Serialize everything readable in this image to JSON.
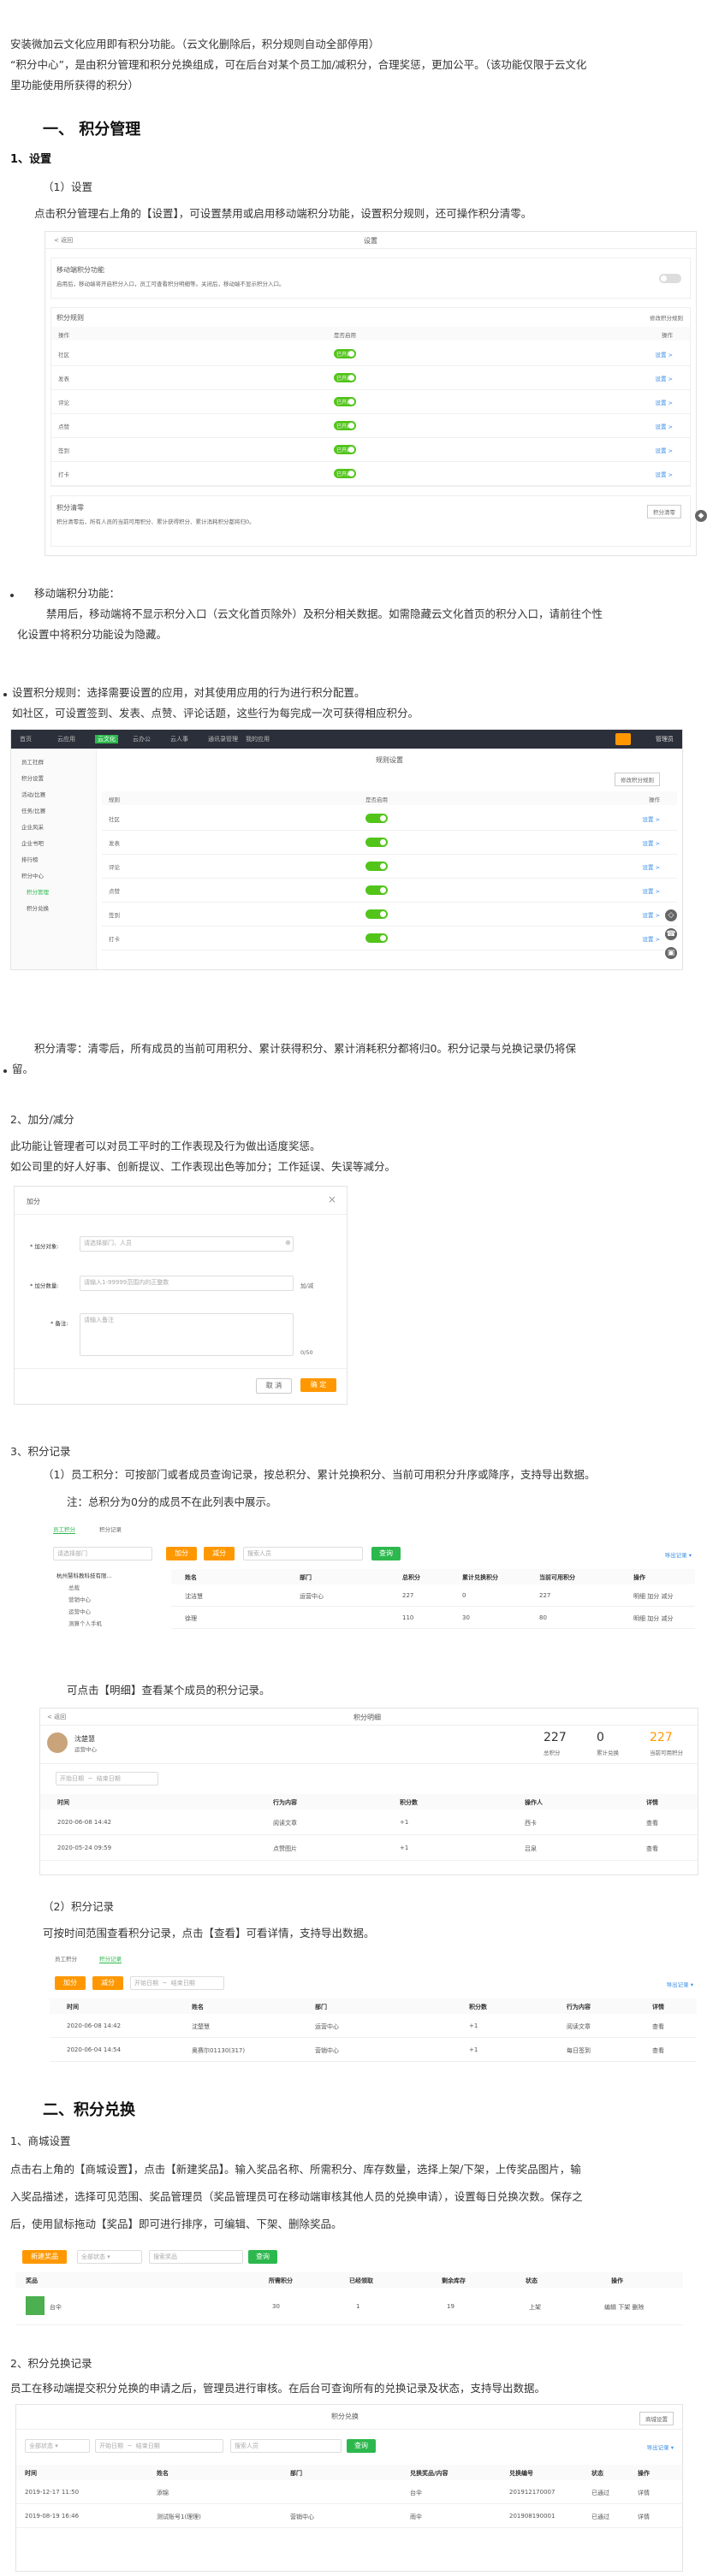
{
  "intro": {
    "line1": "安装微加云文化应用即有积分功能。（云文化删除后，积分规则自动全部停用）",
    "line2": "“积分中心”，是由积分管理和积分兑换组成，可在后台对某个员工加/减积分，合理奖惩，更加公平。（该功能仅限于云文化",
    "line3": "里功能使用所获得的积分）"
  },
  "sec1": {
    "title": "一、 积分管理",
    "s1": "1、设置",
    "s1a": "（1）设置",
    "s1a_text": "点击积分管理右上角的【设置】，可设置禁用或启用移动端积分功能，设置积分规则，还可操作积分清零。",
    "shot1": {
      "back": "< 返回",
      "title": "设置",
      "section1": "移动端积分功能",
      "section1_desc": "启用后，移动端将开启积分入口，员工可查看积分明细等。关闭后，移动端不显示积分入口。",
      "rules_title": "积分规则",
      "rules_link": "修改积分规则",
      "cols": [
        "操作",
        "是否启用",
        "操作"
      ],
      "rows": [
        {
          "name": "社区",
          "on": "已开启",
          "op": "设置 >"
        },
        {
          "name": "发表",
          "on": "已开启",
          "op": "设置 >"
        },
        {
          "name": "评论",
          "on": "已开启",
          "op": "设置 >"
        },
        {
          "name": "点赞",
          "on": "已开启",
          "op": "设置 >"
        },
        {
          "name": "签到",
          "on": "已开启",
          "op": "设置 >"
        },
        {
          "name": "打卡",
          "on": "已开启",
          "op": "设置 >"
        }
      ],
      "clear_title": "积分清零",
      "clear_desc": "积分清零后，所有人员的当前可用积分、累计获得积分、累计消耗积分都将归0。",
      "clear_btn": "积分清零"
    },
    "b1_title": "移动端积分功能：",
    "b1_text": "禁用后，移动端将不显示积分入口（云文化首页除外）及积分相关数据。如需隐藏云文化首页的积分入口，请前往个性",
    "b1_text2": "化设置中将积分功能设为隐藏。",
    "b2_title": "设置积分规则：选择需要设置的应用，对其使用应用的行为进行积分配置。",
    "b2_text": "如社区，可设置签到、发表、点赞、评论话题，这些行为每完成一次可获得相应积分。",
    "shot2": {
      "nav": [
        "首页",
        "云应用",
        "云文化",
        "云办公",
        "云人事",
        "通讯录管理",
        "我的应用"
      ],
      "user": "管理员",
      "sidebar": [
        "员工社群",
        "积分设置",
        "活动/比赛",
        "任务/比赛",
        "企业风采",
        "企业书吧",
        "排行榜",
        "积分中心",
        "积分管理",
        "积分兑换"
      ],
      "title": "规则设置",
      "link": "修改积分规则",
      "cols": [
        "规则",
        "是否启用",
        "操作"
      ],
      "rows": [
        {
          "name": "社区",
          "op": "设置 >"
        },
        {
          "name": "发表",
          "op": "设置 >"
        },
        {
          "name": "评论",
          "op": "设置 >"
        },
        {
          "name": "点赞",
          "op": "设置 >"
        },
        {
          "name": "签到",
          "op": "设置 >"
        },
        {
          "name": "打卡",
          "op": "设置 >"
        }
      ]
    },
    "b3_text": "积分清零：清零后，所有成员的当前可用积分、累计获得积分、累计消耗积分都将归0。积分记录与兑换记录仍将保",
    "b3_text2": "留。",
    "s2": "2、加分/减分",
    "s2_text1": "此功能让管理者可以对员工平时的工作表现及行为做出适度奖惩。",
    "s2_text2": "如公司里的好人好事、创新提议、工作表现出色等加分；工作延误、失误等减分。",
    "shot3": {
      "title": "加分",
      "close": "×",
      "f1_label": "* 加分对象:",
      "f1_ph": "请选择部门、人员",
      "f2_label": "* 加分数量:",
      "f2_ph": "请输入1-99999范围内的正整数",
      "f2_unit": "加/减",
      "f3_label": "* 备注:",
      "f3_ph": "请输入备注",
      "f3_count": "0/50",
      "cancel": "取 消",
      "ok": "确 定"
    },
    "s3": "3、积分记录",
    "s3a": "（1）员工积分：可按部门或者成员查询记录，按总积分、累计兑换积分、当前可用积分升序或降序，支持导出数据。",
    "s3a_note": "注：总积分为0分的成员不在此列表中展示。",
    "shot4": {
      "tabs": [
        "员工积分",
        "积分记录"
      ],
      "export": "导出记录 ▾",
      "filter_ph": "请选择部门",
      "btn1": "加分",
      "btn2": "减分",
      "search_ph": "搜索人员",
      "btn_search": "查询",
      "tree": [
        "杭州慧科教科技有限...",
        "总裁",
        "营销中心",
        "运营中心",
        "测算个人手机"
      ],
      "cols": [
        "姓名",
        "部门",
        "总积分",
        "累计兑换积分",
        "当前可用积分",
        "操作"
      ],
      "rows": [
        {
          "name": "沈洁慧",
          "dept": "运营中心",
          "total": "227",
          "ex": "0",
          "cur": "227",
          "ops": "明细  加分  减分"
        },
        {
          "name": "徐理",
          "dept": "",
          "total": "110",
          "ex": "30",
          "cur": "80",
          "ops": "明细  加分  减分"
        }
      ]
    },
    "s3a_detail": "可点击【明细】查看某个成员的积分记录。",
    "shot5": {
      "back": "< 返回",
      "title": "积分明细",
      "name": "沈楚慧",
      "dept": "运营中心",
      "stats": [
        {
          "v": "227",
          "l": "总积分"
        },
        {
          "v": "0",
          "l": "累计兑换"
        },
        {
          "v": "227",
          "l": "当前可用积分"
        }
      ],
      "date1": "开始日期",
      "date2": "结束日期",
      "cols": [
        "时间",
        "行为内容",
        "积分数",
        "操作人",
        "详情"
      ],
      "rows": [
        {
          "t": "2020-06-08 14:42",
          "a": "阅读文章",
          "n": "+1",
          "o": "西卡",
          "d": "查看"
        },
        {
          "t": "2020-05-24 09:59",
          "a": "点赞图片",
          "n": "+1",
          "o": "吕泉",
          "d": "查看"
        }
      ]
    },
    "s3b": "（2）积分记录",
    "s3b_text": "可按时间范围查看积分记录，点击【查看】可看详情，支持导出数据。",
    "shot6": {
      "tabs": [
        "员工积分",
        "积分记录"
      ],
      "export": "导出记录 ▾",
      "btn1": "加分",
      "btn2": "减分",
      "date1": "开始日期",
      "date2": "结束日期",
      "cols": [
        "时间",
        "姓名",
        "部门",
        "积分数",
        "行为内容",
        "详情"
      ],
      "rows": [
        {
          "t": "2020-06-08 14:42",
          "n": "沈楚慧",
          "d": "运营中心",
          "p": "+1",
          "a": "阅读文章",
          "x": "查看"
        },
        {
          "t": "2020-06-04 14:54",
          "n": "奥赛尔01130(317)",
          "d": "营销中心",
          "p": "+1",
          "a": "每日签到",
          "x": "查看"
        }
      ]
    }
  },
  "sec2": {
    "title": "二、积分兑换",
    "s1": "1、商城设置",
    "s1_text1": "点击右上角的【商城设置】，点击【新建奖品】。输入奖品名称、所需积分、库存数量，选择上架/下架，上传奖品图片，输",
    "s1_text2": "入奖品描述，选择可见范围、奖品管理员（奖品管理员可在移动端审核其他人员的兑换申请），设置每日兑换次数。保存之",
    "s1_text3": "后，使用鼠标拖动【奖品】即可进行排序，可编辑、下架、删除奖品。",
    "shot7": {
      "btn_new": "新建奖品",
      "sel": "全部状态",
      "search_ph": "搜索奖品",
      "btn_search": "查询",
      "cols": [
        "奖品",
        "所需积分",
        "已经领取",
        "剩余库存",
        "状态",
        "操作"
      ],
      "row": {
        "name": "台伞",
        "points": "30",
        "got": "1",
        "left": "19",
        "status": "上架",
        "ops": "编辑  下架  删除"
      }
    },
    "s2": "2、积分兑换记录",
    "s2_text": "员工在移动端提交积分兑换的申请之后，管理员进行审核。在后台可查询所有的兑换记录及状态，支持导出数据。",
    "shot8": {
      "title": "积分兑换",
      "btn_setting": "商城设置",
      "sel": "全部状态",
      "date1": "开始日期",
      "date2": "结束日期",
      "search_ph": "搜索人员",
      "btn_search": "查询",
      "export": "导出记录 ▾",
      "cols": [
        "时间",
        "姓名",
        "部门",
        "兑换奖品/内容",
        "兑换编号",
        "状态",
        "操作"
      ],
      "rows": [
        {
          "t": "2019-12-17 11:50",
          "n": "添锦",
          "d": "",
          "g": "台伞",
          "no": "201912170007",
          "s": "已通过",
          "o": "详情"
        },
        {
          "t": "2019-08-19 16:46",
          "n": "测试账号1(理理)",
          "d": "营销中心",
          "g": "雨伞",
          "no": "201908190001",
          "s": "已通过",
          "o": "详情"
        }
      ]
    }
  },
  "colors": {
    "orange": "#ff9800",
    "green": "#2db84d",
    "blue": "#3a8ee6",
    "dark_nav": "#2b2f3a"
  }
}
